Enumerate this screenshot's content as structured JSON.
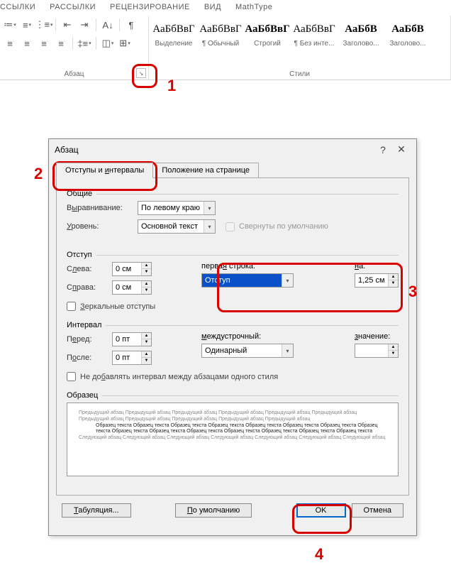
{
  "ribbon": {
    "tabs": [
      "ССЫЛКИ",
      "РАССЫЛКИ",
      "РЕЦЕНЗИРОВАНИЕ",
      "ВИД",
      "MathType"
    ],
    "paragraph_label": "Абзац",
    "styles_label": "Стили",
    "styles": [
      {
        "preview": "АаБбВвГ",
        "name": "Выделение",
        "bold": false
      },
      {
        "preview": "АаБбВвГ",
        "name": "¶ Обычный",
        "bold": false
      },
      {
        "preview": "АаБбВвГ",
        "name": "Строгий",
        "bold": true
      },
      {
        "preview": "АаБбВвГ",
        "name": "¶ Без инте...",
        "bold": false
      },
      {
        "preview": "АаБбВ",
        "name": "Заголово...",
        "bold": true
      },
      {
        "preview": "АаБбВ",
        "name": "Заголово...",
        "bold": true
      }
    ]
  },
  "annotations": {
    "n1": "1",
    "n2": "2",
    "n3": "3",
    "n4": "4"
  },
  "dialog": {
    "title": "Абзац",
    "tab_indents": "Отступы и интервалы",
    "tab_position": "Положение на странице",
    "general_title": "Общие",
    "alignment_label": "Выравнивание:",
    "alignment_value": "По левому краю",
    "level_label": "Уровень:",
    "level_value": "Основной текст",
    "collapsed_label": "Свернуты по умолчанию",
    "indent_title": "Отступ",
    "left_label": "Слева:",
    "left_value": "0 см",
    "right_label": "Справа:",
    "right_value": "0 см",
    "mirror_label": "Зеркальные отступы",
    "firstline_label": "первая строка:",
    "firstline_value": "Отступ",
    "by_label": "на:",
    "by_value": "1,25 см",
    "spacing_title": "Интервал",
    "before_label": "Перед:",
    "before_value": "0 пт",
    "after_label": "После:",
    "after_value": "0 пт",
    "linespacing_label": "междустрочный:",
    "linespacing_value": "Одинарный",
    "at_label": "значение:",
    "at_value": "",
    "nospace_label": "Не добавлять интервал между абзацами одного стиля",
    "preview_title": "Образец",
    "preview_prev": "Предыдущий абзац Предыдущий абзац Предыдущий абзац Предыдущий абзац Предыдущий абзац Предыдущий абзац Предыдущий абзац Предыдущий абзац Предыдущий абзац Предыдущий абзац Предыдущий абзац",
    "preview_sample": "Образец текста Образец текста Образец текста Образец текста Образец текста Образец текста Образец текста Образец текста Образец текста Образец текста Образец текста Образец текста Образец текста Образец текста Образец текста",
    "preview_next": "Следующий абзац Следующий абзац Следующий абзац Следующий абзац Следующий абзац Следующий абзац Следующий абзац",
    "btn_tabs": "Табуляция...",
    "btn_default": "По умолчанию",
    "btn_ok": "OK",
    "btn_cancel": "Отмена"
  }
}
